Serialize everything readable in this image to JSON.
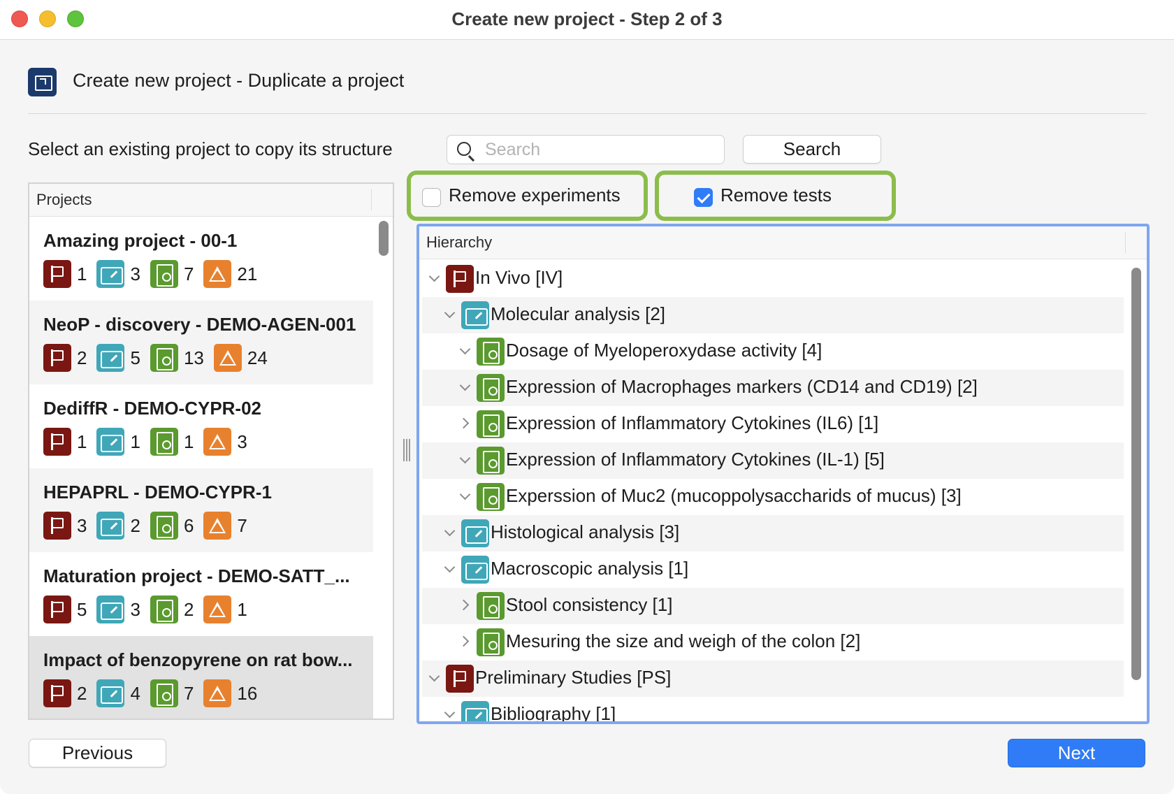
{
  "window": {
    "title": "Create new project - Step 2 of 3"
  },
  "header": {
    "title": "Create new project - Duplicate a project",
    "icon": "project-duplicate-icon"
  },
  "search": {
    "label": "Select an existing project to copy its structure",
    "placeholder": "Search",
    "value": "",
    "button_label": "Search"
  },
  "options": {
    "remove_experiments": {
      "label": "Remove experiments",
      "checked": false
    },
    "remove_tests": {
      "label": "Remove tests",
      "checked": true
    },
    "highlight_color": "#8cbd4c"
  },
  "projects": {
    "header": "Projects",
    "items": [
      {
        "name": "Amazing project - 00-1",
        "studies": "1",
        "experiments": "3",
        "tests": "7",
        "samples": "21"
      },
      {
        "name": "NeoP - discovery - DEMO-AGEN-001",
        "studies": "2",
        "experiments": "5",
        "tests": "13",
        "samples": "24"
      },
      {
        "name": "DediffR - DEMO-CYPR-02",
        "studies": "1",
        "experiments": "1",
        "tests": "1",
        "samples": "3"
      },
      {
        "name": "HEPAPRL - DEMO-CYPR-1",
        "studies": "3",
        "experiments": "2",
        "tests": "6",
        "samples": "7"
      },
      {
        "name": "Maturation project - DEMO-SATT_...",
        "studies": "5",
        "experiments": "3",
        "tests": "2",
        "samples": "1"
      },
      {
        "name": "Impact of benzopyrene on rat bow...",
        "studies": "2",
        "experiments": "4",
        "tests": "7",
        "samples": "16"
      }
    ]
  },
  "hierarchy": {
    "header": "Hierarchy",
    "rows": [
      {
        "label": "In Vivo [IV]",
        "type": "study",
        "level": 0,
        "expanded": true
      },
      {
        "label": "Molecular analysis [2]",
        "type": "experiment",
        "level": 1,
        "expanded": true
      },
      {
        "label": "Dosage of Myeloperoxydase activity [4]",
        "type": "test",
        "level": 2,
        "expanded": true
      },
      {
        "label": "Expression of Macrophages markers (CD14 and CD19) [2]",
        "type": "test",
        "level": 2,
        "expanded": true
      },
      {
        "label": "Expression of Inflammatory Cytokines (IL6) [1]",
        "type": "test",
        "level": 2,
        "expanded": false
      },
      {
        "label": "Expression of Inflammatory Cytokines (IL-1) [5]",
        "type": "test",
        "level": 2,
        "expanded": true
      },
      {
        "label": "Experssion of Muc2 (mucoppolysaccharids of mucus) [3]",
        "type": "test",
        "level": 2,
        "expanded": true
      },
      {
        "label": "Histological analysis [3]",
        "type": "experiment",
        "level": 1,
        "expanded": true
      },
      {
        "label": "Macroscopic analysis [1]",
        "type": "experiment",
        "level": 1,
        "expanded": true
      },
      {
        "label": "Stool consistency [1]",
        "type": "test",
        "level": 2,
        "expanded": false
      },
      {
        "label": "Mesuring the size and weigh of the colon [2]",
        "type": "test",
        "level": 2,
        "expanded": false
      },
      {
        "label": "Preliminary Studies [PS]",
        "type": "study",
        "level": 0,
        "expanded": true
      },
      {
        "label": "Bibliography [1]",
        "type": "experiment",
        "level": 1,
        "expanded": true
      }
    ]
  },
  "footer": {
    "previous_label": "Previous",
    "next_label": "Next"
  },
  "colors": {
    "accent": "#2f7cf6",
    "study": "#7a1712",
    "experiment": "#3fa7b8",
    "test": "#5a9a2e",
    "sample": "#e8812e",
    "selection_outline": "#7fa6ef"
  }
}
